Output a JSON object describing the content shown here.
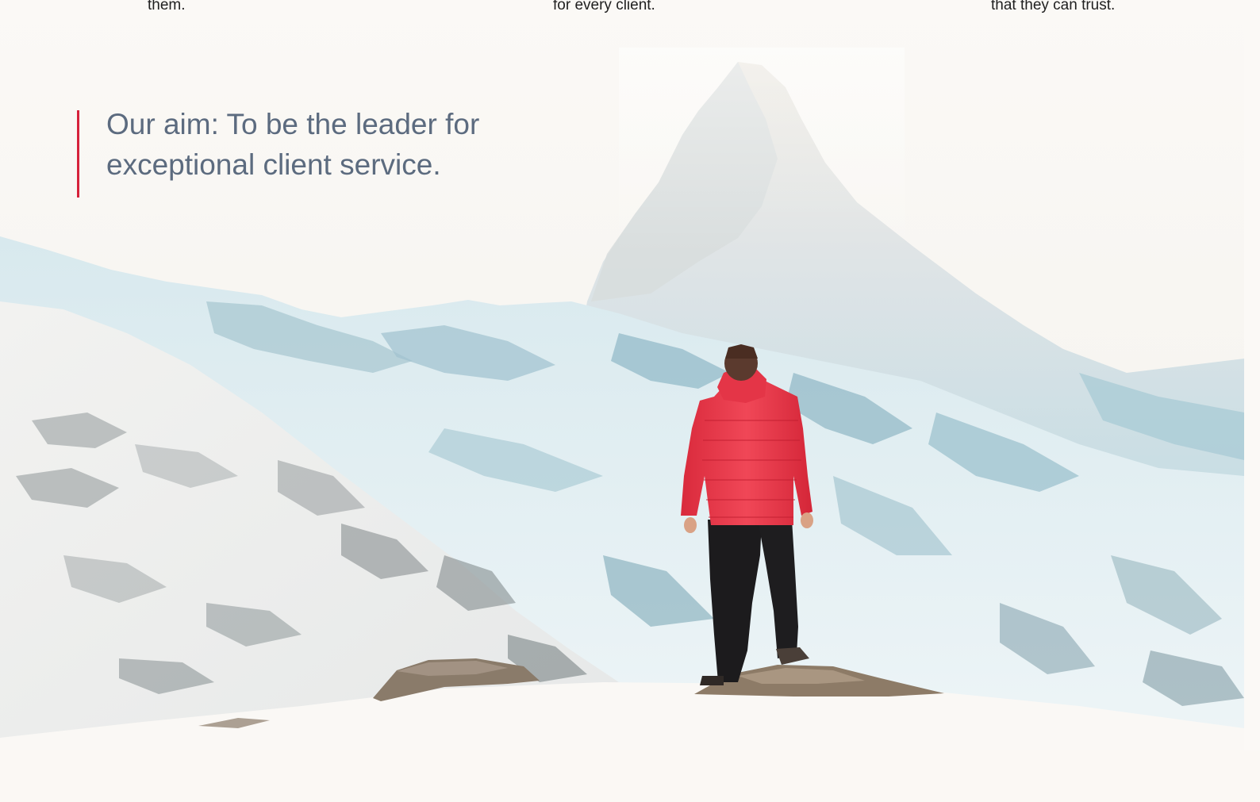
{
  "top_fragments": {
    "col1": "them.",
    "col2": "for every client.",
    "col3": "that they can trust."
  },
  "aim": {
    "line1": "Our aim: To be the leader for",
    "line2": "exceptional client service."
  },
  "colors": {
    "accent": "#d6213a",
    "aim_text": "#5c6b7f",
    "jacket": "#ea3a4b"
  }
}
